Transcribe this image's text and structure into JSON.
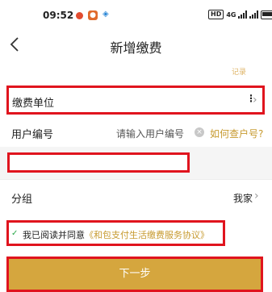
{
  "status_bar": {
    "time": "09:52",
    "icons": [
      "notification-red-icon",
      "app-orange-icon",
      "app-blue-icon"
    ],
    "network_chip": "HD",
    "signal": "4G",
    "battery_icon": "battery-icon"
  },
  "header": {
    "title": "新增缴费",
    "back_icon": "chevron-left-icon"
  },
  "faded_link": "记录",
  "form": {
    "unit_label": "缴费单位",
    "user_no_label": "用户编号",
    "user_no_placeholder": "请输入用户编号",
    "query_link": "如何查户号?",
    "group_label": "分组",
    "group_value": "我家"
  },
  "agreement": {
    "text": "我已阅读并同意",
    "link": "《和包支付生活缴费服务协议》",
    "checked": true
  },
  "next_button": "下一步",
  "colors": {
    "accent": "#d5a63e",
    "highlight": "#e0141e",
    "link": "#c79a2f",
    "check": "#2aa84a"
  }
}
